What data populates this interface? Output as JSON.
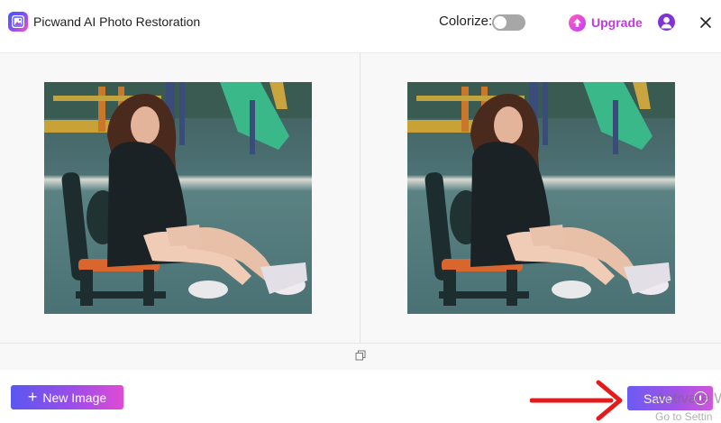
{
  "app": {
    "title": "Picwand AI Photo Restoration"
  },
  "header": {
    "colorize_label": "Colorize:",
    "colorize_enabled": false,
    "upgrade_label": "Upgrade",
    "icons": [
      "app-logo-icon",
      "upgrade-arrow-icon",
      "user-avatar-icon",
      "close-icon"
    ]
  },
  "workspace": {
    "panels": [
      {
        "name": "original-image",
        "subject": "woman seated on bench in playground"
      },
      {
        "name": "restored-image",
        "subject": "woman seated on bench in playground"
      }
    ],
    "compare_icon": "compare-icon"
  },
  "footer": {
    "new_image_label": "New Image",
    "save_label": "Save"
  },
  "watermark": {
    "line1": "Activate W",
    "line2": "Go to Settin"
  },
  "colors": {
    "accent_gradient_start": "#5a57f0",
    "accent_gradient_end": "#e04bd6",
    "upgrade_text": "#c438e6",
    "annotation_arrow": "#e51b1b"
  }
}
